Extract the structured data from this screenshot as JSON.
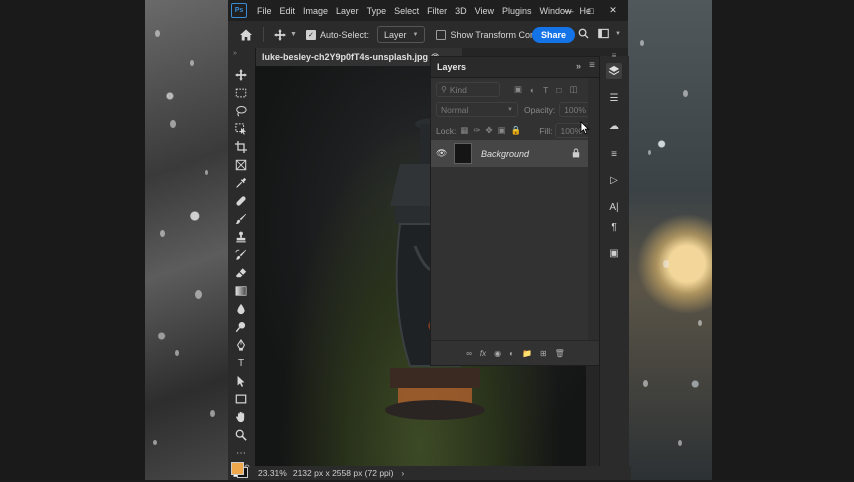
{
  "menubar": {
    "logo": "Ps",
    "items": [
      "File",
      "Edit",
      "Image",
      "Layer",
      "Type",
      "Select",
      "Filter",
      "3D",
      "View",
      "Plugins",
      "Window",
      "He"
    ]
  },
  "options": {
    "auto_select_label": "Auto-Select:",
    "auto_select_checked": true,
    "target_value": "Layer",
    "show_transform_label": "Show Transform Controls",
    "share_label": "Share"
  },
  "document": {
    "tab_title": "luke-besley-ch2Y9p0fT4s-unsplash.jpg @"
  },
  "status": {
    "zoom": "23.31%",
    "info": "2132 px x 2558 px (72 ppi)"
  },
  "layers_panel": {
    "title": "Layers",
    "kind_placeholder": "Kind",
    "blend_mode": "Normal",
    "opacity_label": "Opacity:",
    "opacity_value": "100%",
    "lock_label": "Lock:",
    "fill_label": "Fill:",
    "fill_value": "100%",
    "layers": [
      {
        "name": "Background",
        "visible": true,
        "locked": true
      }
    ],
    "footer_fx": "fx"
  },
  "colors": {
    "foreground": "#f0a84c",
    "background": "#111111",
    "accent": "#1473e6"
  },
  "icons": {
    "toolbar": [
      "move-icon",
      "marquee-icon",
      "lasso-icon",
      "object-select-icon",
      "crop-icon",
      "frame-icon",
      "eyedropper-icon",
      "healing-icon",
      "brush-icon",
      "stamp-icon",
      "history-brush-icon",
      "eraser-icon",
      "gradient-icon",
      "blur-icon",
      "dodge-icon",
      "pen-icon",
      "type-icon",
      "path-select-icon",
      "rectangle-icon",
      "hand-icon",
      "zoom-icon",
      "more-icon"
    ],
    "dock": [
      "layers-icon",
      "adjustments-icon",
      "libraries-icon",
      "properties-icon",
      "stamp-panel-icon",
      "character-icon",
      "paragraph-icon",
      "glyphs-icon"
    ]
  }
}
